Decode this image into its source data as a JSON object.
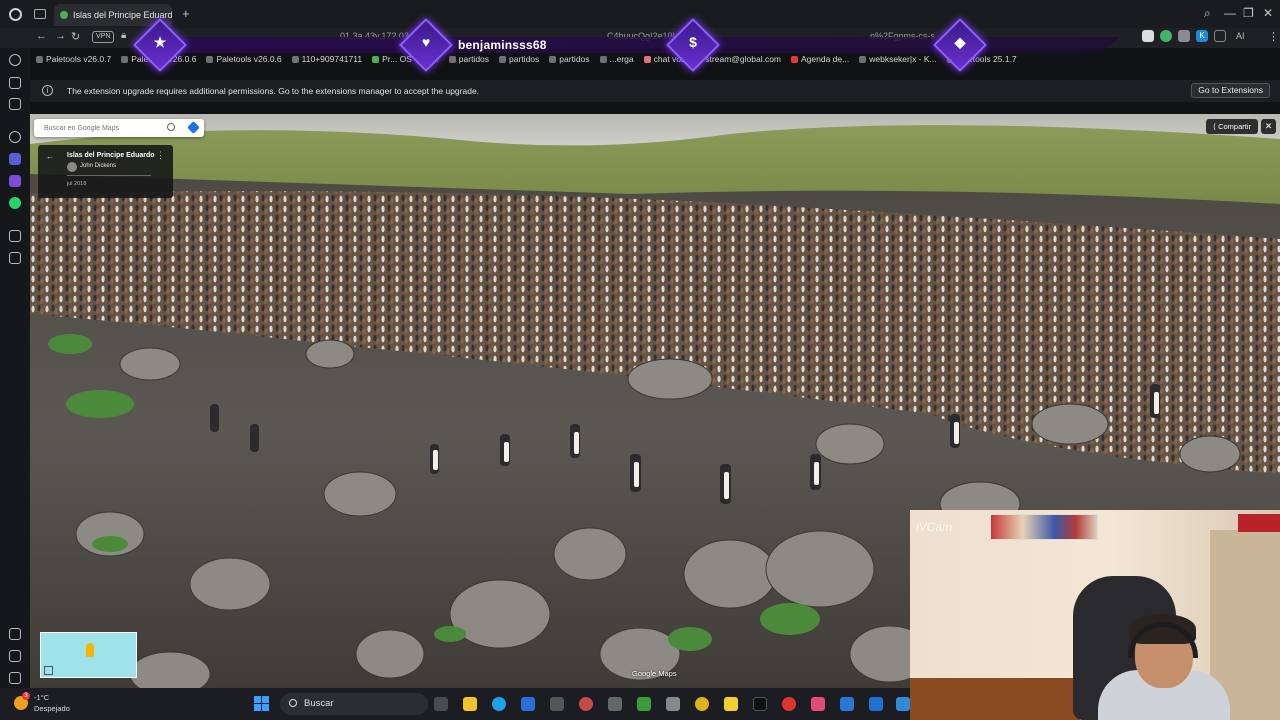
{
  "browser": {
    "tab_title": "Islas del Principe Eduardo",
    "new_tab": "+",
    "vpn_label": "VPN",
    "url_fragments": [
      "01.3a,43y,172.03",
      "C4huucQg!2e10!",
      "n%2Fgpms-cs-s"
    ],
    "ai_label": "AI",
    "bookmarks": [
      "Paletools v26.0.7",
      "Paletools v26.0.6",
      "Paletools v26.0.6",
      "110+909741711",
      "Pr... OS - Fut...",
      "partidos",
      "partidos",
      "partidos",
      "...erga",
      "chat voz",
      "stream@global.com",
      "Agenda de...",
      "webkseker|x - K...",
      "paletools 25.1.7"
    ]
  },
  "overlay": {
    "streamer_name": "benjaminsss68",
    "badges": [
      {
        "icon": "star-icon",
        "glyph": "★"
      },
      {
        "icon": "heart-icon",
        "glyph": "♥"
      },
      {
        "icon": "dollar-icon",
        "glyph": "$"
      },
      {
        "icon": "diamond-icon",
        "glyph": "◆"
      }
    ]
  },
  "notification": {
    "text": "The extension upgrade requires additional permissions. Go to the extensions manager to accept the upgrade.",
    "button": "Go to Extensions"
  },
  "maps": {
    "search_placeholder": "Buscar en Google Maps",
    "place_title": "Islas del Principe Eduardo",
    "author": "John Dickens",
    "date": "jul 2018",
    "share_label": "Compartir",
    "close_glyph": "✕",
    "brand": "Google Maps"
  },
  "webcam": {
    "label": "iVCam"
  },
  "taskbar": {
    "weather_temp": "-1°C",
    "weather_desc": "Despejado",
    "weather_badge": "3",
    "search_label": "Buscar"
  },
  "colors": {
    "accent_purple": "#7c3cff",
    "maps_blue": "#1a73e8",
    "windows_blue": "#3aa0ff"
  }
}
